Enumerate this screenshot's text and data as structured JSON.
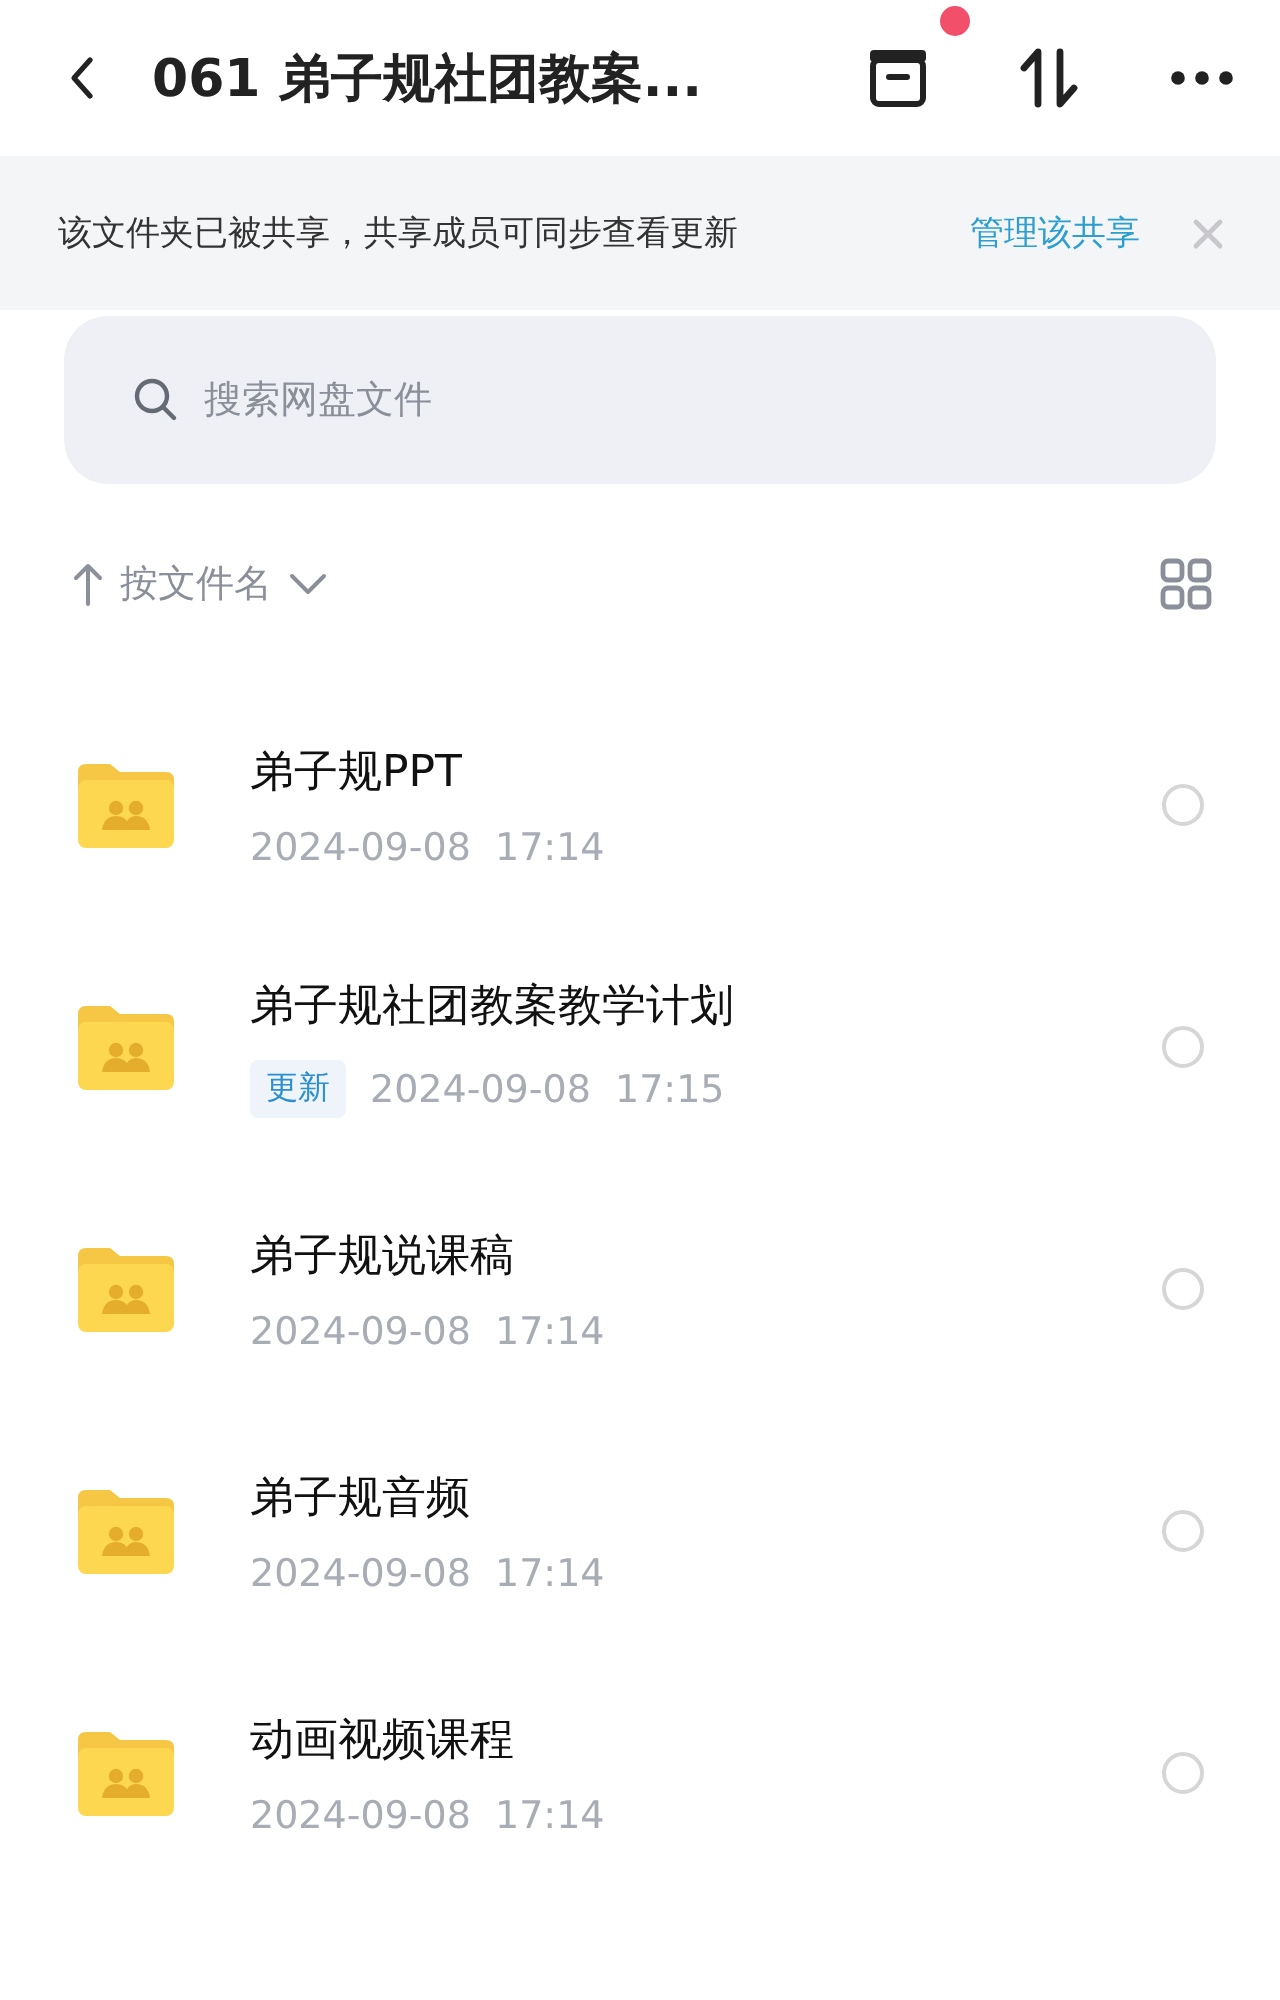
{
  "header": {
    "title": "061 弟子规社团教案...",
    "notification_dot": true
  },
  "share_banner": {
    "message": "该文件夹已被共享，共享成员可同步查看更新",
    "action": "管理该共享"
  },
  "search": {
    "placeholder": "搜索网盘文件"
  },
  "sort": {
    "label": "按文件名"
  },
  "files": [
    {
      "name": "弟子规PPT",
      "date": "2024-09-08  17:14",
      "selected": false
    },
    {
      "name": "弟子规社团教案教学计划",
      "badge": "更新",
      "date": "2024-09-08  17:15",
      "selected": false
    },
    {
      "name": "弟子规说课稿",
      "date": "2024-09-08  17:14",
      "selected": false
    },
    {
      "name": "弟子规音频",
      "date": "2024-09-08  17:14",
      "selected": false
    },
    {
      "name": "动画视频课程",
      "date": "2024-09-08  17:14",
      "selected": false
    }
  ]
}
